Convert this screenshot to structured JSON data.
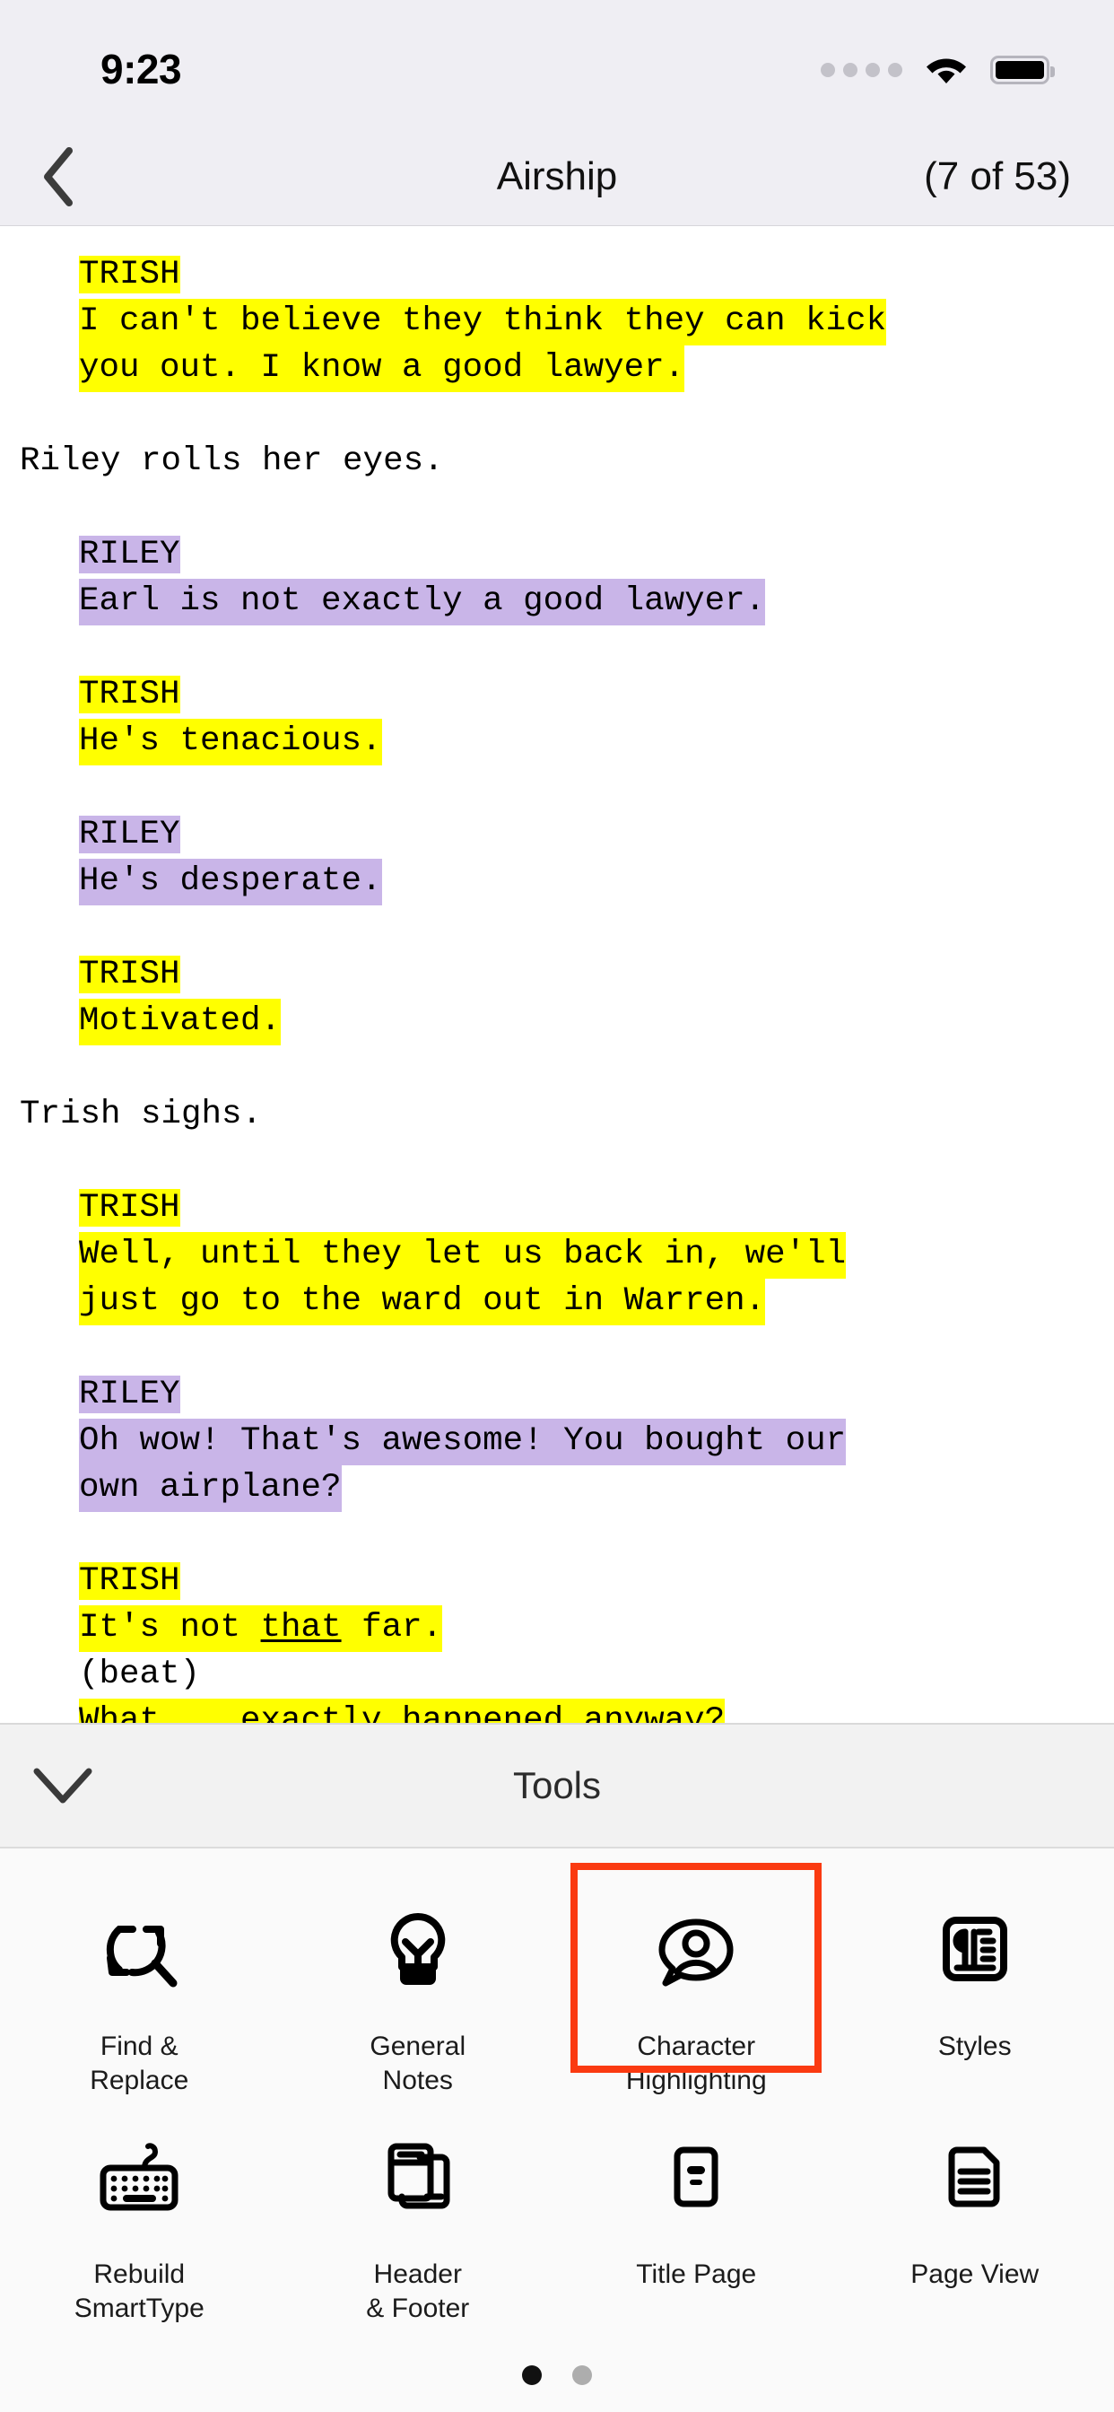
{
  "status_bar": {
    "time": "9:23",
    "signal_icon": "signal-dots-icon",
    "wifi_icon": "wifi-icon",
    "battery_icon": "battery-full-icon"
  },
  "nav_bar": {
    "back_icon": "chevron-left-icon",
    "title": "Airship",
    "page_count": "(7 of 53)"
  },
  "script": {
    "blocks": [
      {
        "type": "dialogue",
        "character": "TRISH",
        "highlight": "#ffff00",
        "lines": [
          "I can't believe they think they can kick",
          "you out. I know a good lawyer."
        ]
      },
      {
        "type": "action",
        "text": "Riley rolls her eyes."
      },
      {
        "type": "dialogue",
        "character": "RILEY",
        "highlight": "#c9b5e8",
        "lines": [
          "Earl is not exactly a good lawyer."
        ]
      },
      {
        "type": "dialogue",
        "character": "TRISH",
        "highlight": "#ffff00",
        "lines": [
          "He's tenacious."
        ]
      },
      {
        "type": "dialogue",
        "character": "RILEY",
        "highlight": "#c9b5e8",
        "lines": [
          "He's desperate."
        ]
      },
      {
        "type": "dialogue",
        "character": "TRISH",
        "highlight": "#ffff00",
        "lines": [
          "Motivated."
        ]
      },
      {
        "type": "action",
        "text": "Trish sighs."
      },
      {
        "type": "dialogue",
        "character": "TRISH",
        "highlight": "#ffff00",
        "lines": [
          "Well, until they let us back in, we'll",
          "just go to the ward out in Warren."
        ]
      },
      {
        "type": "dialogue",
        "character": "RILEY",
        "highlight": "#c9b5e8",
        "lines": [
          "Oh wow! That's awesome! You bought our",
          "own airplane?"
        ]
      },
      {
        "type": "dialogue",
        "character": "TRISH",
        "highlight": "#ffff00",
        "line_a_pre": "It's not ",
        "line_a_underlined": "that",
        "line_a_post": " far.",
        "parenthetical": "(beat)",
        "line_b": "What... exactly happened anyway?"
      }
    ]
  },
  "tools_panel": {
    "collapse_icon": "chevron-down-icon",
    "title": "Tools",
    "selection_color": "#fa3a11",
    "items": [
      {
        "label": "Find &\nReplace",
        "icon": "find-replace-icon",
        "selected": false
      },
      {
        "label": "General\nNotes",
        "icon": "lightbulb-icon",
        "selected": false
      },
      {
        "label": "Character\nHighlighting",
        "icon": "character-highlighting-icon",
        "selected": true
      },
      {
        "label": "Styles",
        "icon": "pilcrow-styles-icon",
        "selected": false
      },
      {
        "label": "Rebuild\nSmartType",
        "icon": "keyboard-icon",
        "selected": false
      },
      {
        "label": "Header\n& Footer",
        "icon": "header-footer-icon",
        "selected": false
      },
      {
        "label": "Title Page",
        "icon": "title-page-icon",
        "selected": false
      },
      {
        "label": "Page View",
        "icon": "page-view-icon",
        "selected": false
      }
    ],
    "page_dots": {
      "total": 2,
      "active_index": 0
    }
  }
}
